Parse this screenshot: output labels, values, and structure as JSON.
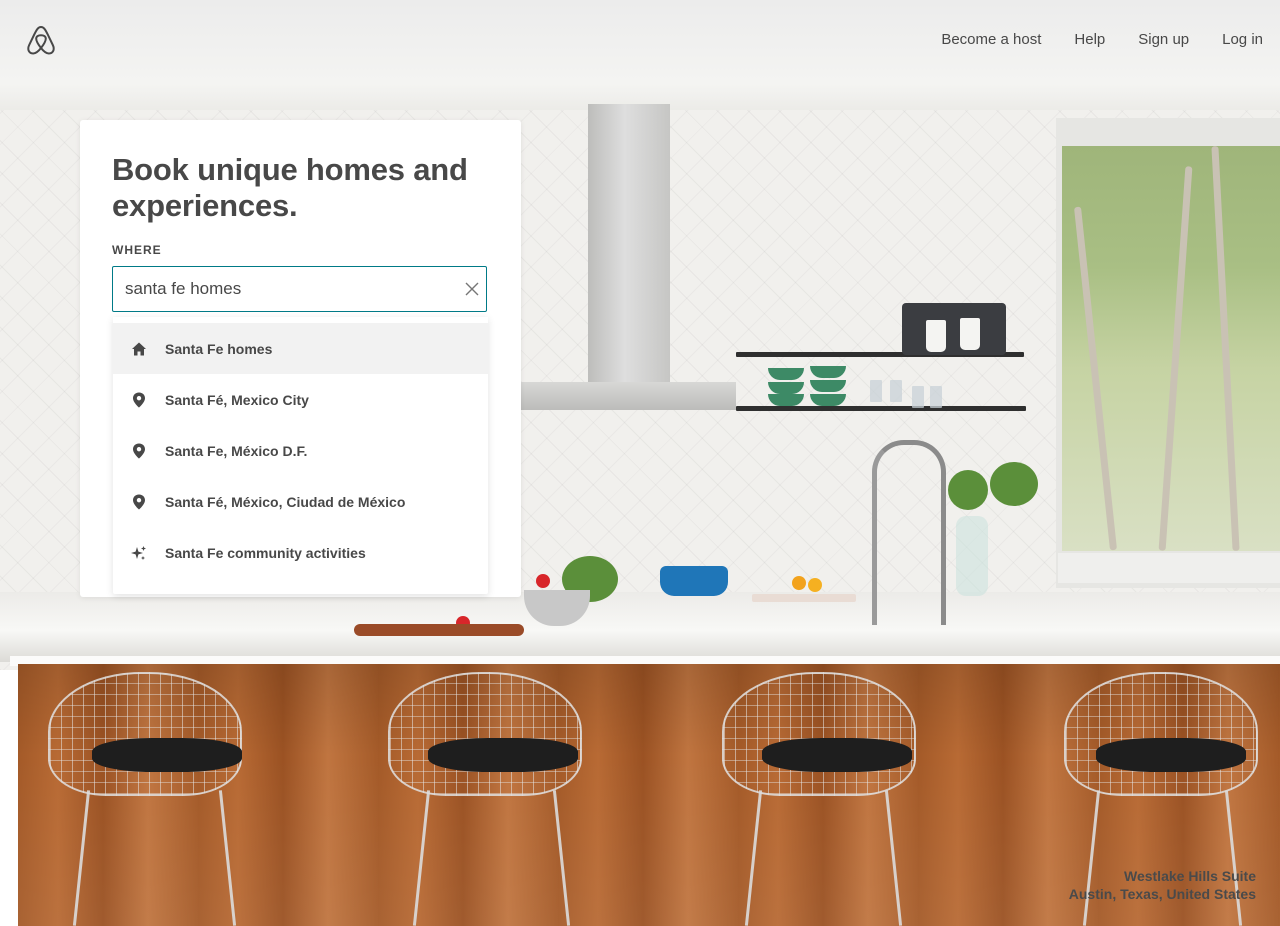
{
  "header": {
    "logo_icon": "airbnb-belo-icon",
    "nav": [
      {
        "label": "Become a host"
      },
      {
        "label": "Help"
      },
      {
        "label": "Sign up"
      },
      {
        "label": "Log in"
      }
    ]
  },
  "hero": {
    "title": "Book unique homes and experiences."
  },
  "search": {
    "label": "WHERE",
    "value": "santa fe homes",
    "clear_icon": "close-icon",
    "accent_color": "#007a87",
    "suggestions": [
      {
        "label": "Santa Fe homes",
        "icon": "home-icon",
        "highlighted": true
      },
      {
        "label": "Santa Fé, Mexico City",
        "icon": "location-pin-icon"
      },
      {
        "label": "Santa Fe, México D.F.",
        "icon": "location-pin-icon"
      },
      {
        "label": "Santa Fé, México, Ciudad de México",
        "icon": "location-pin-icon"
      },
      {
        "label": "Santa Fe community activities",
        "icon": "sparkle-icon"
      }
    ]
  },
  "photo_credit": {
    "listing": "Westlake Hills Suite",
    "location": "Austin, Texas, United States"
  }
}
